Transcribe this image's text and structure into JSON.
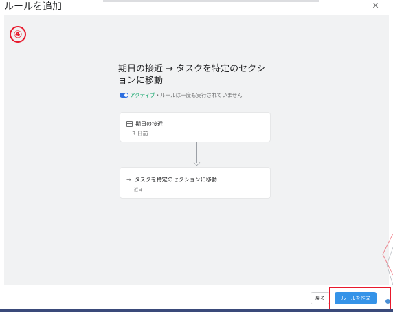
{
  "dialog": {
    "title": "ルールを追加",
    "close_label": "×"
  },
  "step_marker": "④",
  "rule": {
    "title": "期日の接近 → タスクを特定のセクションに移動",
    "status_active": "アクティブ",
    "status_note": "・ルールは一度も実行されていません"
  },
  "trigger": {
    "icon": "calendar-icon",
    "label": "期日の接近",
    "detail": "3 日前"
  },
  "action": {
    "icon": "arrow-right-icon",
    "label": "タスクを特定のセクションに移動",
    "detail": "近日"
  },
  "footer": {
    "back_label": "戻る",
    "create_label": "ルールを作成"
  },
  "colors": {
    "accent": "#3593e8",
    "active": "#14a76c",
    "annotation": "#e8192c",
    "canvas_bg": "#f1f2f3"
  }
}
